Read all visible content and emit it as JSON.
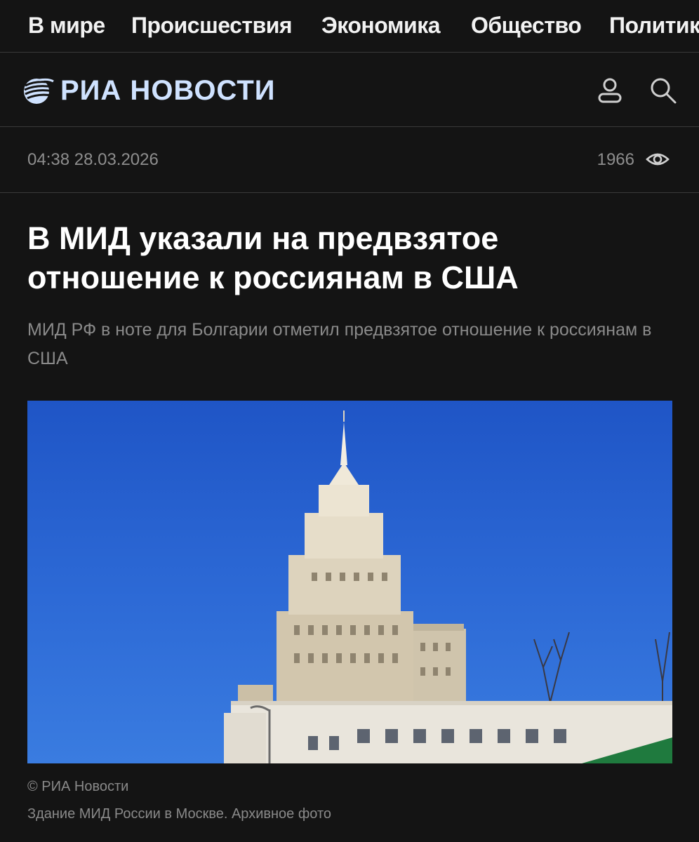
{
  "nav": {
    "items": [
      "В мире",
      "Происшествия",
      "Экономика",
      "Общество",
      "Политика"
    ]
  },
  "header": {
    "logo_text": "РИА НОВОСТИ",
    "logo_icon": "ria-globe-icon",
    "icons": [
      "user-icon",
      "search-icon"
    ],
    "accent_color": "#cfe2ff"
  },
  "article": {
    "time": "04:38 28.03.2026",
    "views": "1966",
    "views_icon": "eye-icon",
    "title": "В МИД указали на предвзятое отношение к россиянам в США",
    "subtitle": "МИД РФ в ноте для Болгарии отметил предвзятое отношение к россиянам в США",
    "image": {
      "credit": "© РИА Новости",
      "caption": "Здание МИД России в Москве. Архивное фото"
    }
  },
  "colors": {
    "background": "#141414",
    "divider": "#3a3a3a",
    "muted_text": "#8a8a8a",
    "sky": "#2d6ad6"
  }
}
